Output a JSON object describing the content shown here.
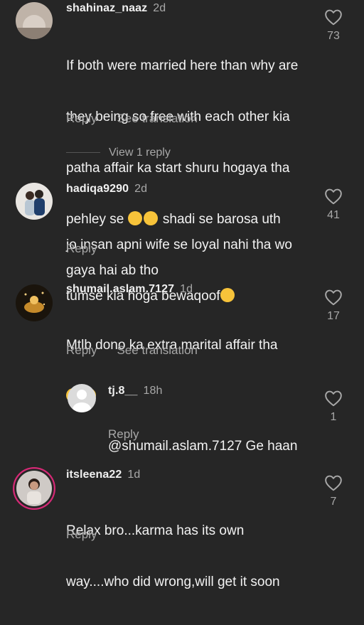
{
  "comments": [
    {
      "username": "shahinaz_naaz",
      "time": "2d",
      "text_lines": [
        "If both were married here than why are",
        "they being so free with each other kia",
        "patha affair ka start shuru hogaya tha",
        "pehley se",
        "gaya hai ab tho"
      ],
      "text_line4_tail": " shadi se barosa uth",
      "reply_label": "Reply",
      "translate_label": "See translation",
      "likes": "73",
      "view_replies": "View 1 reply"
    },
    {
      "username": "hadiqa9290",
      "time": "2d",
      "text_lines": [
        "jo insan apni wife se loyal nahi tha wo",
        "tumse kia hoga bewaqoof"
      ],
      "reply_label": "Reply",
      "likes": "41"
    },
    {
      "username": "shumail.aslam.7127",
      "time": "1d",
      "text_lines": [
        "Mtlb dono ka extra marital affair tha"
      ],
      "reply_label": "Reply",
      "translate_label": "See translation",
      "likes": "17"
    },
    {
      "username": "tj.8__",
      "time": "18h",
      "text_lines": [
        "@shumail.aslam.7127 Ge haan"
      ],
      "reply_label": "Reply",
      "likes": "1"
    },
    {
      "username": "itsleena22",
      "time": "1d",
      "text_lines": [
        "Relax bro...karma has its own",
        "way....who did wrong,will get it soon"
      ],
      "reply_label": "Reply",
      "likes": "7"
    }
  ],
  "colors": {
    "background": "#262626",
    "secondary_text": "#a8a8a8",
    "emoji": "#f7c33a",
    "story_ring": "#d62976"
  },
  "icons": [
    "heart-outline-icon",
    "pensive-emoji",
    "eye-roll-emoji",
    "hushed-emoji"
  ]
}
